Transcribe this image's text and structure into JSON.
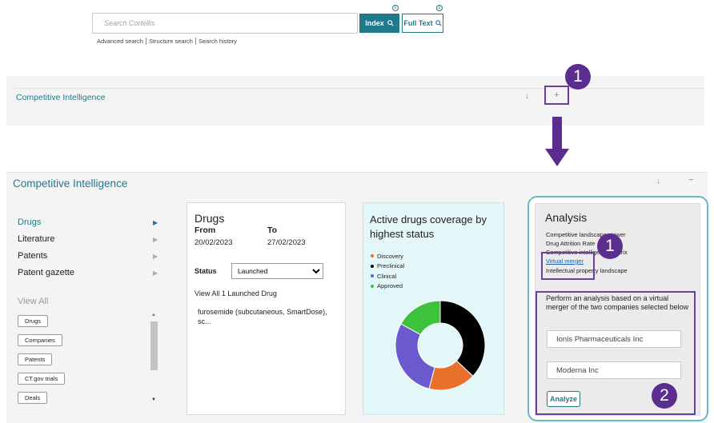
{
  "search": {
    "placeholder": "Search Cortellis",
    "index_label": "Index",
    "fulltext_label": "Full Text",
    "info_glyph": "i",
    "links": [
      "Advanced search",
      "Structure search",
      "Search history"
    ]
  },
  "collapsed_panel": {
    "title": "Competitive Intelligence",
    "download_glyph": "↓",
    "expand_glyph": "+"
  },
  "callouts": {
    "step1": "1",
    "step2": "2"
  },
  "expanded_panel": {
    "title": "Competitive Intelligence",
    "download_glyph": "↓",
    "collapse_glyph": "−"
  },
  "nav": {
    "items": [
      {
        "label": "Drugs",
        "active": true
      },
      {
        "label": "Literature",
        "active": false
      },
      {
        "label": "Patents",
        "active": false
      },
      {
        "label": "Patent gazette",
        "active": false
      }
    ],
    "view_all_label": "View All",
    "pills": [
      "Drugs",
      "Companies",
      "Patents",
      "CT.gov trials",
      "Deals"
    ]
  },
  "drugs_card": {
    "title": "Drugs",
    "from_label": "From",
    "to_label": "To",
    "from_date": "20/02/2023",
    "to_date": "27/02/2023",
    "status_label": "Status",
    "status_value": "Launched",
    "view_all_text": "View All 1 Launched Drug",
    "drug_entry": "furosemide (subcutaneous, SmartDose), sc..."
  },
  "coverage_card": {
    "title": "Active drugs coverage by highest status",
    "legend": [
      {
        "label": "Discovery",
        "color": "#e8702a"
      },
      {
        "label": "Preclinical",
        "color": "#000000"
      },
      {
        "label": "Clinical",
        "color": "#6a5acd"
      },
      {
        "label": "Approved",
        "color": "#3cc23c"
      }
    ]
  },
  "chart_data": {
    "type": "pie",
    "title": "Active drugs coverage by highest status",
    "categories": [
      "Preclinical",
      "Discovery",
      "Clinical",
      "Approved"
    ],
    "values": [
      37,
      17,
      29,
      17
    ],
    "colors": [
      "#000000",
      "#e8702a",
      "#6a5acd",
      "#3cc23c"
    ],
    "donut": true
  },
  "analysis": {
    "title": "Analysis",
    "items": [
      {
        "label": "Competitive landscape viewer",
        "link": false
      },
      {
        "label": "Drug Attrition Rate",
        "link": false
      },
      {
        "label": "Competitive intelligence matrix",
        "link": false
      },
      {
        "label": "Virtual merger",
        "link": true
      },
      {
        "label": "Intellectual property landscape",
        "link": false
      }
    ],
    "merger_description": "Perform an analysis based on a virtual merger of the two companies selected below",
    "company1": "Ionis Pharmaceuticals Inc",
    "company2": "Moderna Inc",
    "analyze_label": "Analyze"
  }
}
